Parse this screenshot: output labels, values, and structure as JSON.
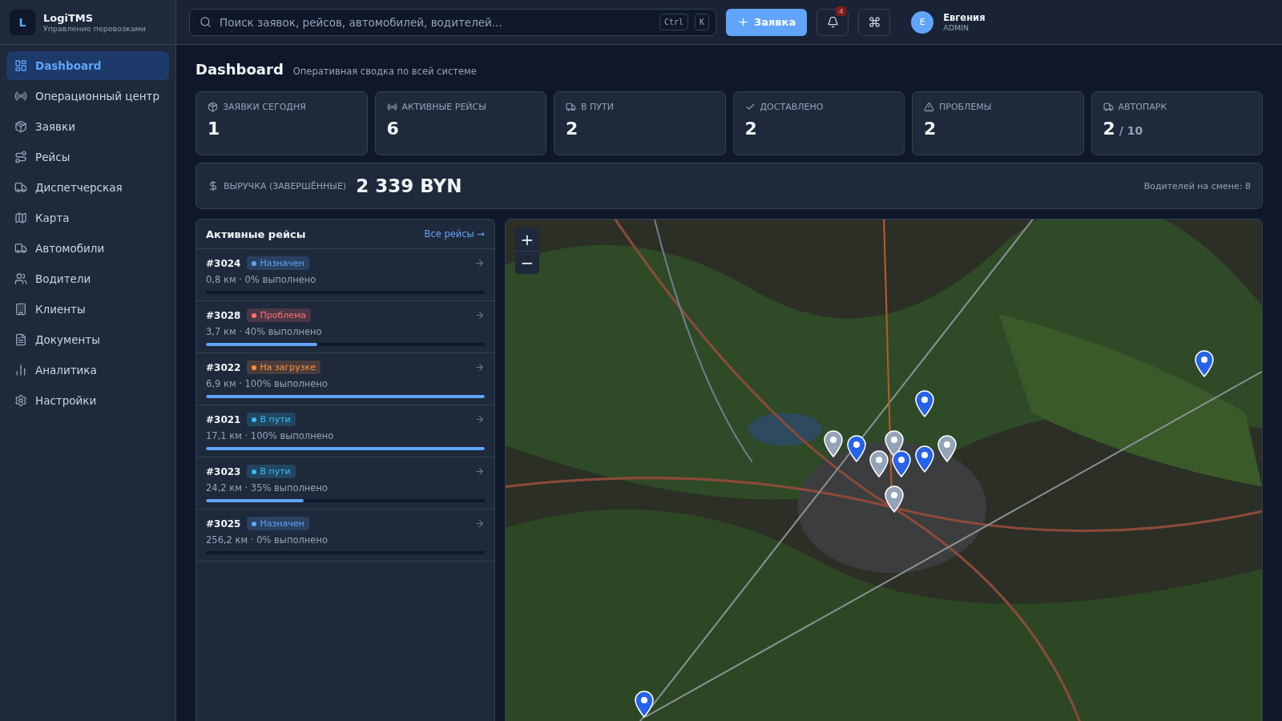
{
  "brand": {
    "logo": "L",
    "name": "LogiTMS",
    "subtitle": "Управление перевозками"
  },
  "sidebar": {
    "items": [
      {
        "label": "Dashboard",
        "selected": true
      },
      {
        "label": "Операционный центр",
        "selected": false
      },
      {
        "label": "Заявки",
        "selected": false
      },
      {
        "label": "Рейсы",
        "selected": false
      },
      {
        "label": "Диспетчерская",
        "selected": false
      },
      {
        "label": "Карта",
        "selected": false
      },
      {
        "label": "Автомобили",
        "selected": false
      },
      {
        "label": "Водители",
        "selected": false
      },
      {
        "label": "Клиенты",
        "selected": false
      },
      {
        "label": "Документы",
        "selected": false
      },
      {
        "label": "Аналитика",
        "selected": false
      },
      {
        "label": "Настройки",
        "selected": false
      }
    ]
  },
  "topbar": {
    "search": {
      "placeholder": "Поиск заявок, рейсов, автомобилей, водителей...",
      "keys": [
        "Ctrl",
        "K"
      ]
    },
    "new_button": "Заявка",
    "notifications": "4",
    "user": {
      "initial": "E",
      "name": "Евгения",
      "role": "ADMIN"
    }
  },
  "page": {
    "title": "Dashboard",
    "subtitle": "Оперативная сводка по всей системе"
  },
  "stats": [
    {
      "label": "ЗАЯВКИ СЕГОДНЯ",
      "value": "1"
    },
    {
      "label": "АКТИВНЫЕ РЕЙСЫ",
      "value": "6"
    },
    {
      "label": "В ПУТИ",
      "value": "2"
    },
    {
      "label": "ДОСТАВЛЕНО",
      "value": "2"
    },
    {
      "label": "ПРОБЛЕМЫ",
      "value": "2"
    },
    {
      "label": "АВТОПАРК",
      "value": "2",
      "total": "/ 10"
    }
  ],
  "revenue": {
    "label": "ВЫРУЧКА (ЗАВЕРШЁННЫЕ)",
    "value": "2 339 BYN",
    "drivers": "Водителей на смене: 8"
  },
  "trips": {
    "title": "Активные рейсы",
    "link": "Все рейсы →",
    "rows": [
      {
        "id": "#3024",
        "status": "Назначен",
        "color": "#60a5fa",
        "meta": "0,8 км · 0% выполнено"
      },
      {
        "id": "#3028",
        "status": "Проблема",
        "color": "#f87171",
        "meta": "3,7 км · 40% выполнено",
        "level": 0.4
      },
      {
        "id": "#3022",
        "status": "На загрузке",
        "color": "#fb923c",
        "meta": "6,9 км · 100% выполнено",
        "level": 1
      },
      {
        "id": "#3021",
        "status": "В пути",
        "color": "#38bdf8",
        "meta": "17,1 км · 100% выполнено",
        "level": 1
      },
      {
        "id": "#3023",
        "status": "В пути",
        "color": "#38bdf8",
        "meta": "24,2 км · 35% выполнено",
        "level": 0.35
      },
      {
        "id": "#3025",
        "status": "Назначен",
        "color": "#60a5fa",
        "meta": "256,2 км · 0% выполнено"
      }
    ]
  },
  "map": {
    "zoom_in": "+",
    "zoom_out": "−"
  }
}
